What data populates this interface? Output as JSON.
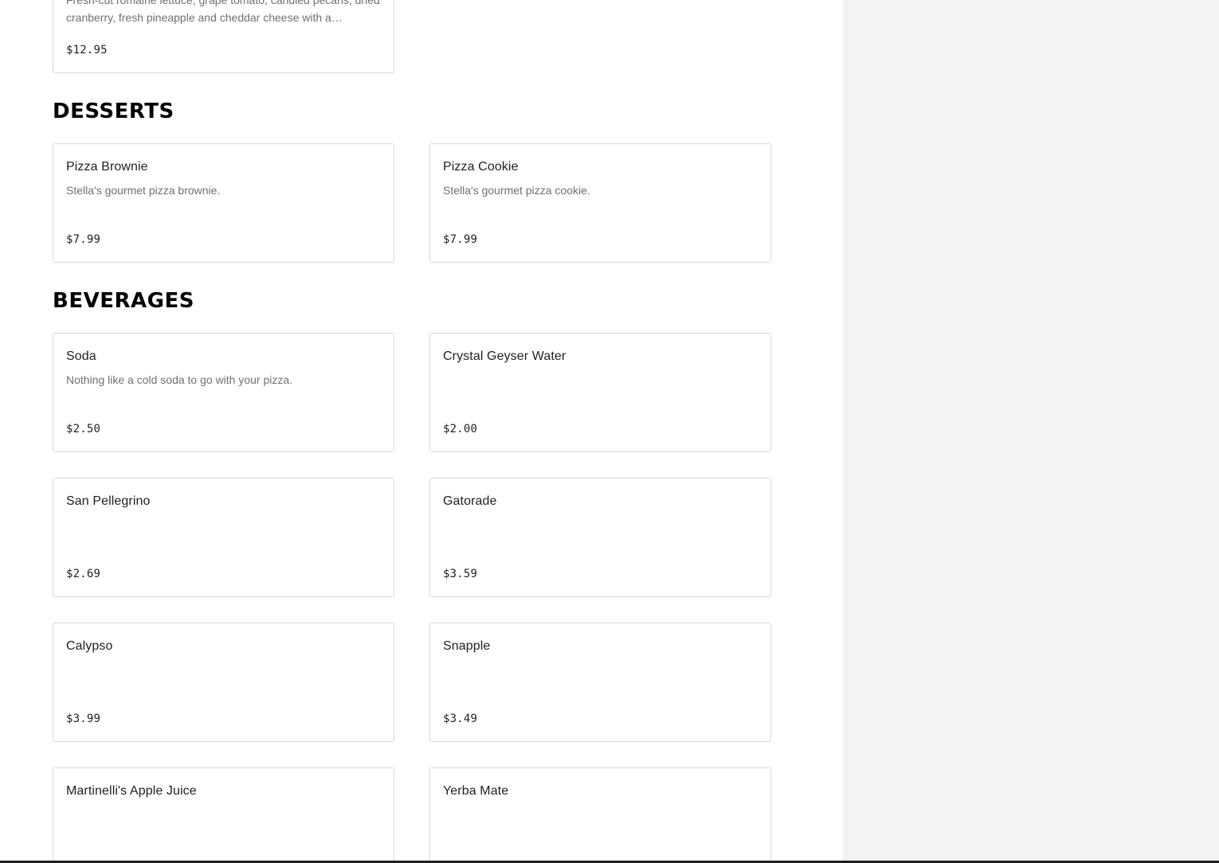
{
  "salads": {
    "partial_item": {
      "description": "Fresh-cut romaine lettuce, grape tomato, candied pecans, dried cranberry, fresh pineapple and cheddar cheese with a…",
      "price": "$12.95"
    }
  },
  "desserts": {
    "heading": "DESSERTS",
    "items": [
      {
        "name": "Pizza Brownie",
        "description": "Stella's gourmet pizza brownie.",
        "price": "$7.99"
      },
      {
        "name": "Pizza Cookie",
        "description": "Stella's gourmet pizza cookie.",
        "price": "$7.99"
      }
    ]
  },
  "beverages": {
    "heading": "BEVERAGES",
    "items": [
      {
        "name": "Soda",
        "description": "Nothing like a cold soda to go with your pizza.",
        "price": "$2.50"
      },
      {
        "name": "Crystal Geyser Water",
        "description": "",
        "price": "$2.00"
      },
      {
        "name": "San Pellegrino",
        "description": "",
        "price": "$2.69"
      },
      {
        "name": "Gatorade",
        "description": "",
        "price": "$3.59"
      },
      {
        "name": "Calypso",
        "description": "",
        "price": "$3.99"
      },
      {
        "name": "Snapple",
        "description": "",
        "price": "$3.49"
      },
      {
        "name": "Martinelli's Apple Juice",
        "description": "",
        "price": ""
      },
      {
        "name": "Yerba Mate",
        "description": "",
        "price": ""
      }
    ]
  },
  "colors": {
    "card_border": "#d9d9d9",
    "side_panel": "#f4f3f1",
    "text_primary": "#1f1f1f",
    "text_secondary": "#707070"
  }
}
